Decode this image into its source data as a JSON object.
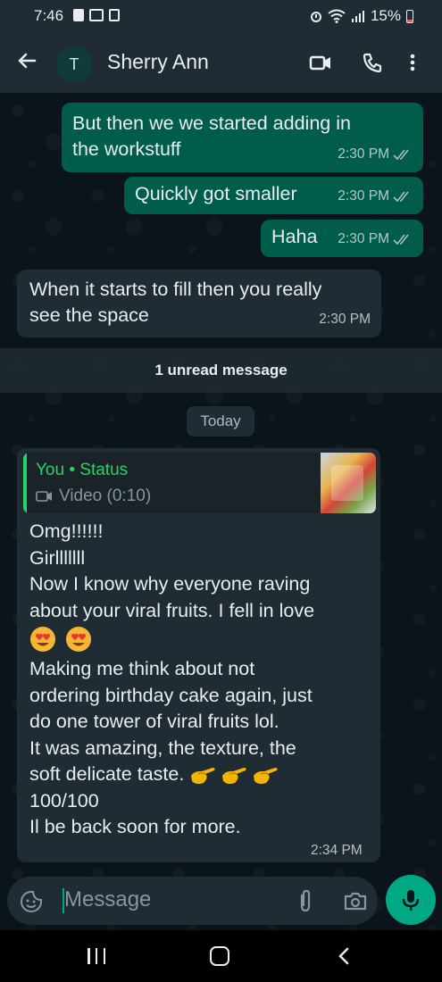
{
  "status_bar": {
    "time": "7:46",
    "battery": "15%",
    "battery_color": "#f15c6d"
  },
  "header": {
    "avatar_initial": "T",
    "contact_name": "Sherry Ann",
    "icons": [
      "back-arrow-icon",
      "video-call-icon",
      "phone-icon",
      "more-vert-icon"
    ]
  },
  "messages": [
    {
      "direction": "outgoing",
      "text": "But then we we started adding in\nthe workstuff",
      "time": "2:30 PM",
      "read": true
    },
    {
      "direction": "outgoing",
      "text": "Quickly got smaller",
      "time": "2:30 PM",
      "read": true
    },
    {
      "direction": "outgoing",
      "text": "Haha",
      "time": "2:30 PM",
      "read": true
    },
    {
      "direction": "incoming",
      "text": "When it starts to fill then you really\nsee the space",
      "time": "2:30 PM"
    }
  ],
  "unread_banner": "1 unread message",
  "date_divider": "Today",
  "status_reply": {
    "quote_title": "You • Status",
    "quote_subtitle": "Video (0:10)",
    "lines": {
      "l1": "Omg!!!!!!",
      "l2": "Girlllllll",
      "l3": "Now I know why everyone raving\nabout your viral fruits. I fell in love",
      "l5": "Making me think about not\nordering birthday cake again, just\ndo one tower of viral fruits lol.\nIt was amazing, the texture, the\nsoft delicate taste.",
      "l6": "100/100\nIl be back soon for more."
    },
    "emojis": [
      "smiling-face-with-heart-eyes",
      "smiling-face-with-heart-eyes",
      "hand-with-index-finger-and-thumb-crossed",
      "hand-with-index-finger-and-thumb-crossed",
      "hand-with-index-finger-and-thumb-crossed"
    ],
    "time": "2:34 PM"
  },
  "composer": {
    "placeholder": "Message"
  },
  "colors": {
    "accent": "#00a884",
    "outgoing_bubble": "#005c4b",
    "incoming_bubble": "#202c33",
    "status_green": "#25d366"
  }
}
